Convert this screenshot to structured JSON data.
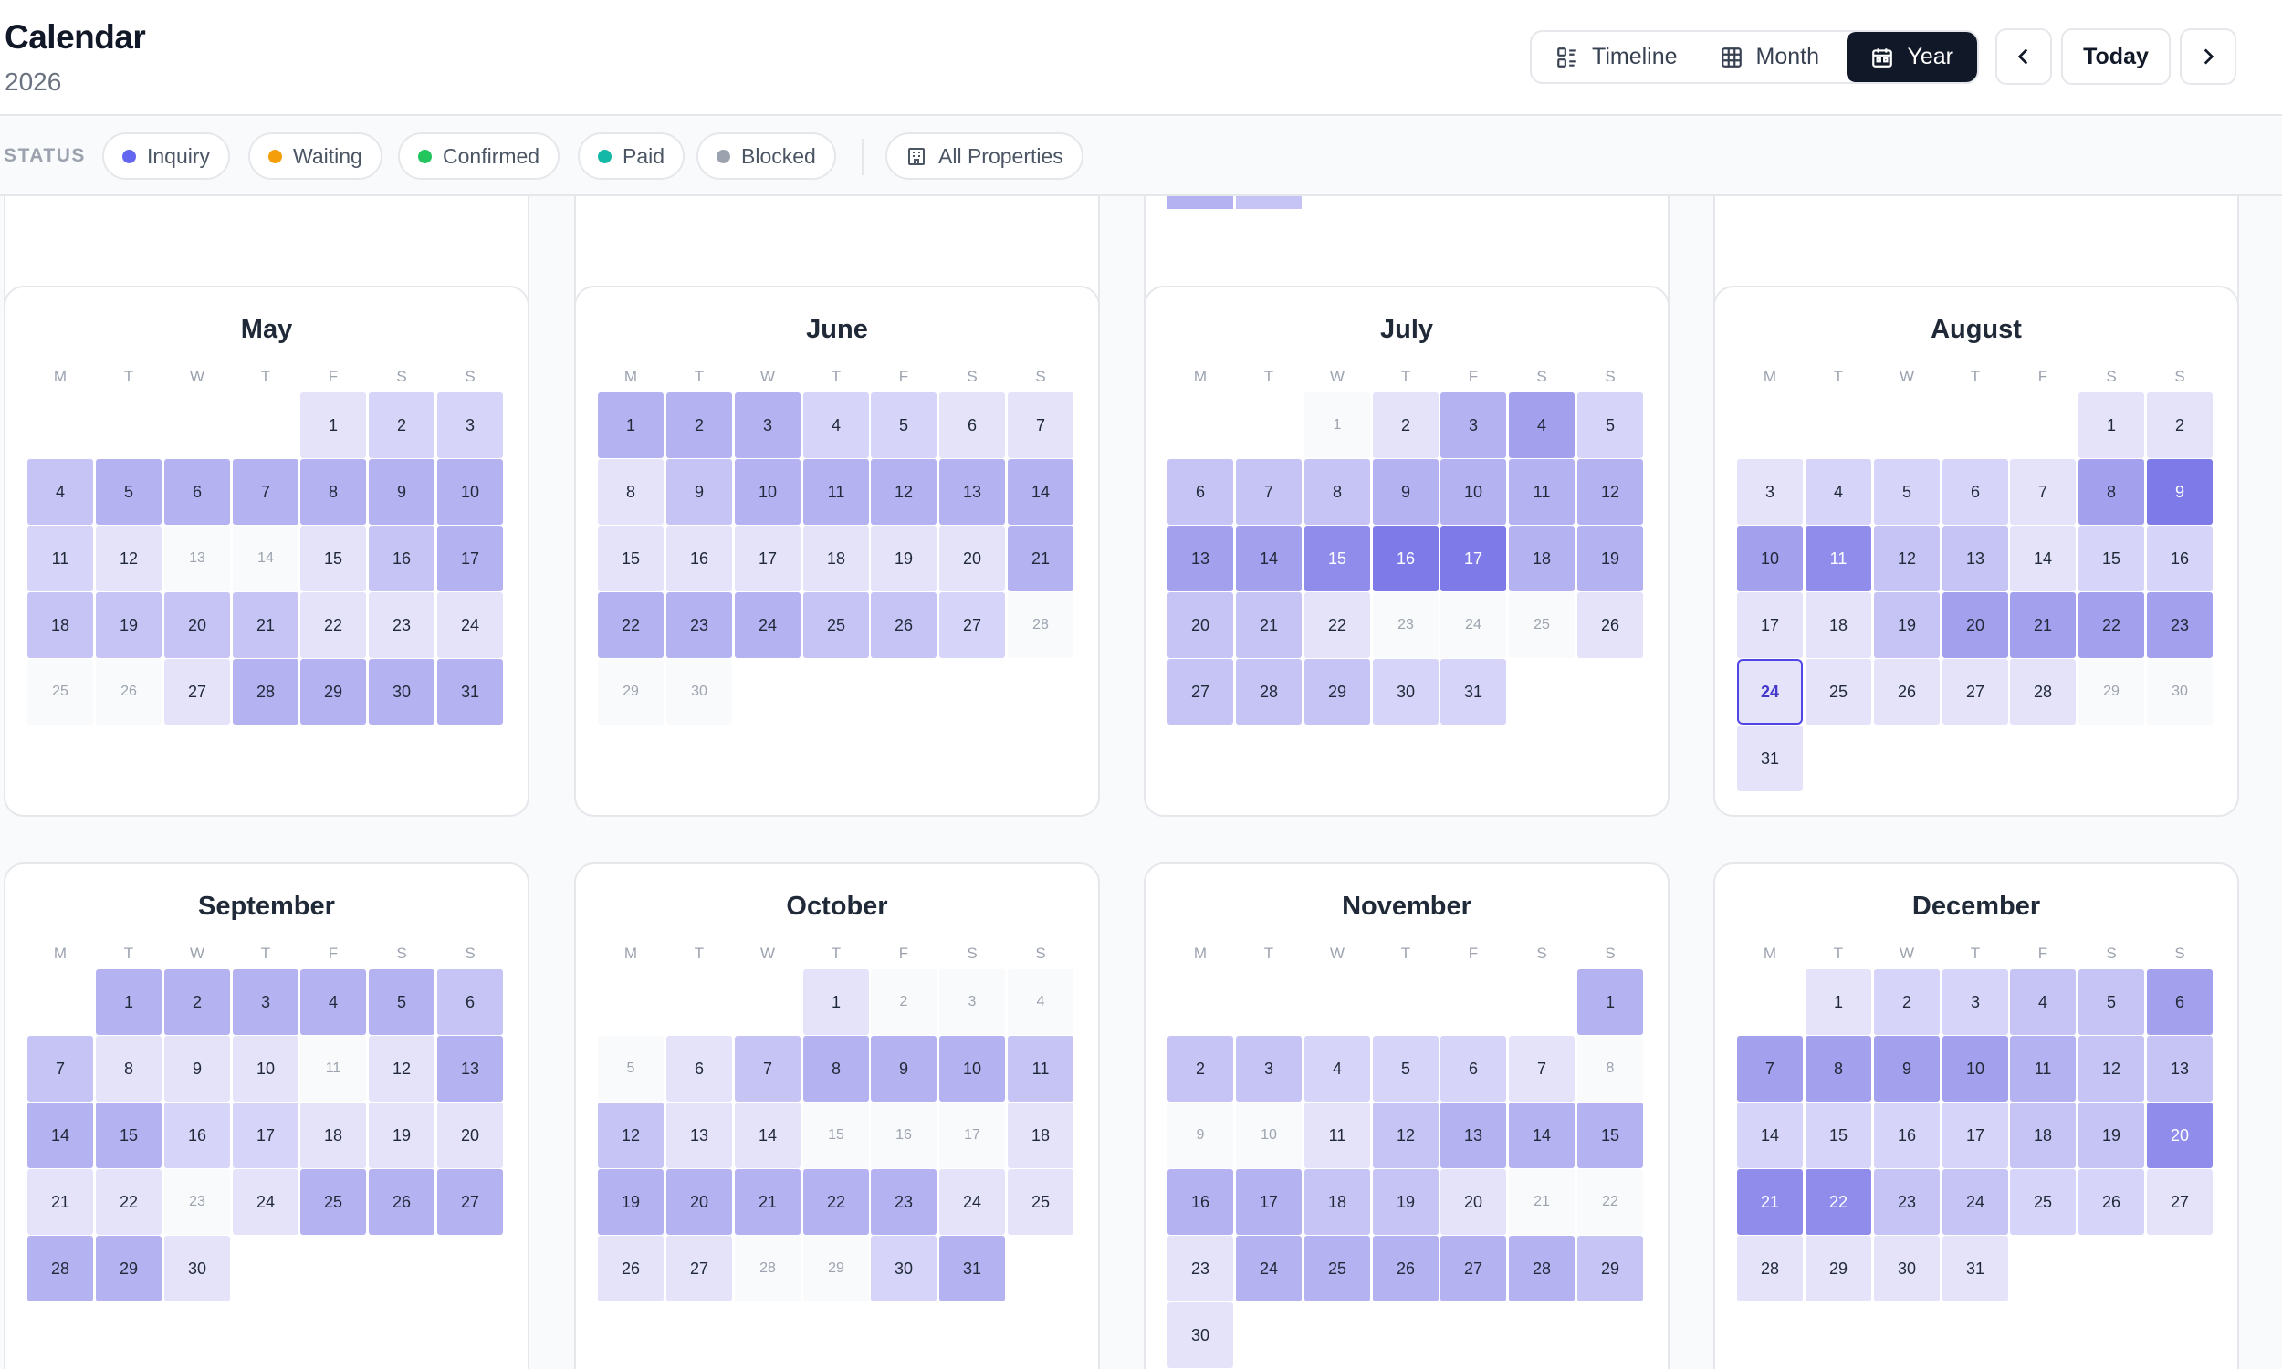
{
  "header": {
    "title": "Calendar",
    "year": "2026",
    "views": [
      {
        "label": "Timeline",
        "icon": "timeline-icon",
        "active": false
      },
      {
        "label": "Month",
        "icon": "grid-icon",
        "active": false
      },
      {
        "label": "Year",
        "icon": "calendar-icon",
        "active": true
      }
    ],
    "prev_icon": "chevron-left-icon",
    "today_label": "Today",
    "next_icon": "chevron-right-icon"
  },
  "filters": {
    "label": "STATUS",
    "statuses": [
      {
        "label": "Inquiry",
        "color": "#6366f1"
      },
      {
        "label": "Waiting",
        "color": "#f59e0b"
      },
      {
        "label": "Confirmed",
        "color": "#22c55e"
      },
      {
        "label": "Paid",
        "color": "#14b8a6"
      },
      {
        "label": "Blocked",
        "color": "#9ca3af"
      }
    ],
    "properties_label": "All Properties",
    "properties_icon": "building-icon"
  },
  "calendar": {
    "weekday_letters": [
      "M",
      "T",
      "W",
      "T",
      "F",
      "S",
      "S"
    ],
    "today": {
      "month": "August",
      "day": 24
    },
    "scale_colors": [
      "#f9fafb",
      "#e5e3fa",
      "#d6d4f8",
      "#c6c4f5",
      "#b4b2f1",
      "#a3a0ee",
      "#8f8ceb",
      "#7e7ae8"
    ],
    "months": [
      {
        "name": "May",
        "offset": 4,
        "days": 31,
        "levels": [
          1,
          2,
          2,
          3,
          4,
          4,
          4,
          4,
          4,
          4,
          2,
          1,
          0,
          0,
          1,
          3,
          4,
          3,
          3,
          3,
          3,
          1,
          1,
          1,
          0,
          0,
          1,
          4,
          4,
          4,
          4
        ]
      },
      {
        "name": "June",
        "offset": 0,
        "days": 30,
        "levels": [
          4,
          4,
          4,
          2,
          2,
          1,
          1,
          1,
          3,
          4,
          4,
          4,
          4,
          4,
          1,
          1,
          1,
          1,
          1,
          1,
          4,
          4,
          4,
          4,
          3,
          3,
          2,
          0,
          0,
          0
        ]
      },
      {
        "name": "July",
        "offset": 2,
        "days": 31,
        "levels": [
          0,
          1,
          4,
          5,
          2,
          3,
          3,
          3,
          4,
          4,
          4,
          4,
          5,
          5,
          6,
          7,
          7,
          4,
          4,
          3,
          3,
          1,
          0,
          0,
          0,
          1,
          3,
          3,
          3,
          2,
          2
        ]
      },
      {
        "name": "August",
        "offset": 5,
        "days": 31,
        "levels": [
          1,
          1,
          1,
          2,
          2,
          2,
          1,
          5,
          7,
          5,
          6,
          3,
          3,
          1,
          2,
          2,
          1,
          1,
          3,
          5,
          5,
          5,
          5,
          1,
          1,
          1,
          1,
          1,
          0,
          0,
          1
        ]
      },
      {
        "name": "September",
        "offset": 1,
        "days": 30,
        "levels": [
          4,
          4,
          4,
          4,
          4,
          3,
          3,
          1,
          1,
          1,
          0,
          1,
          4,
          4,
          4,
          2,
          2,
          1,
          1,
          1,
          1,
          1,
          0,
          1,
          4,
          4,
          4,
          4,
          4,
          1
        ]
      },
      {
        "name": "October",
        "offset": 3,
        "days": 31,
        "levels": [
          1,
          0,
          0,
          0,
          0,
          1,
          3,
          4,
          4,
          4,
          3,
          3,
          1,
          1,
          0,
          0,
          0,
          1,
          4,
          4,
          4,
          4,
          4,
          1,
          1,
          1,
          1,
          0,
          0,
          2,
          4
        ]
      },
      {
        "name": "November",
        "offset": 6,
        "days": 30,
        "levels": [
          4,
          3,
          3,
          2,
          2,
          2,
          1,
          0,
          0,
          0,
          1,
          3,
          4,
          4,
          4,
          4,
          4,
          3,
          3,
          1,
          0,
          0,
          1,
          4,
          4,
          4,
          4,
          4,
          3,
          1
        ]
      },
      {
        "name": "December",
        "offset": 1,
        "days": 31,
        "levels": [
          1,
          2,
          2,
          3,
          3,
          5,
          5,
          5,
          5,
          5,
          4,
          3,
          3,
          2,
          2,
          2,
          2,
          3,
          3,
          6,
          6,
          6,
          3,
          3,
          2,
          2,
          1,
          1,
          1,
          1,
          1
        ]
      }
    ]
  }
}
